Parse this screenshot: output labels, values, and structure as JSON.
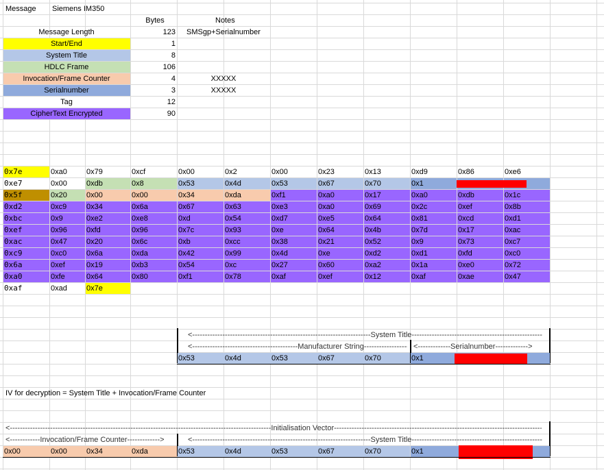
{
  "colors": {
    "start_end": "#ffff00",
    "system_title": "#b4c7e7",
    "hdlc_frame": "#c5e0b4",
    "invocation": "#f8cbad",
    "serialnumber": "#8faadc",
    "tag": "#ffffff",
    "ciphertext": "#9966ff",
    "tag_cell": "#bf8f00",
    "redaction": "#ff0000"
  },
  "header": {
    "message_label": "Message",
    "message_value": "Siemens IM350",
    "bytes_header": "Bytes",
    "notes_header": "Notes"
  },
  "summary": [
    {
      "label": "Message Length",
      "bytes": "123",
      "notes": "SMSgp+Serialnumber",
      "color": ""
    },
    {
      "label": "Start/End",
      "bytes": "1",
      "notes": "",
      "color": "#ffff00"
    },
    {
      "label": "System Title",
      "bytes": "8",
      "notes": "",
      "color": "#b4c7e7"
    },
    {
      "label": "HDLC Frame",
      "bytes": "106",
      "notes": "",
      "color": "#c5e0b4"
    },
    {
      "label": "Invocation/Frame Counter",
      "bytes": "4",
      "notes": "XXXXX",
      "color": "#f8cbad"
    },
    {
      "label": "Serialnumber",
      "bytes": "3",
      "notes": "XXXXX",
      "color": "#8faadc"
    },
    {
      "label": "Tag",
      "bytes": "12",
      "notes": "",
      "color": "#ffffff"
    },
    {
      "label": "CipherText Encrypted",
      "bytes": "90",
      "notes": "",
      "color": "#9966ff"
    }
  ],
  "hex_rows": [
    [
      "0x7e",
      "0xa0",
      "0x79",
      "0xcf",
      "0x00",
      "0x2",
      "0x00",
      "0x23",
      "0x13",
      "0xd9",
      "0x86",
      "0xe6"
    ],
    [
      "0xe7",
      "0x00",
      "0xdb",
      "0x8",
      "0x53",
      "0x4d",
      "0x53",
      "0x67",
      "0x70",
      "0x1",
      "",
      ""
    ],
    [
      "0x5f",
      "0x20",
      "0x00",
      "0x00",
      "0x34",
      "0xda",
      "0xf1",
      "0xa0",
      "0x17",
      "0xa0",
      "0xdb",
      "0x1c"
    ],
    [
      "0xd2",
      "0xc9",
      "0x34",
      "0x6a",
      "0x67",
      "0x63",
      "0xe3",
      "0xa0",
      "0x69",
      "0x2c",
      "0xef",
      "0x8b"
    ],
    [
      "0xbc",
      "0x9",
      "0xe2",
      "0xe8",
      "0xd",
      "0x54",
      "0xd7",
      "0xe5",
      "0x64",
      "0x81",
      "0xcd",
      "0xd1"
    ],
    [
      "0xef",
      "0x96",
      "0xfd",
      "0x96",
      "0x7c",
      "0x93",
      "0xe",
      "0x64",
      "0x4b",
      "0x7d",
      "0x17",
      "0xac"
    ],
    [
      "0xac",
      "0x47",
      "0x20",
      "0x6c",
      "0xb",
      "0xcc",
      "0x38",
      "0x21",
      "0x52",
      "0x9",
      "0x73",
      "0xc7"
    ],
    [
      "0xc9",
      "0xc0",
      "0x6a",
      "0xda",
      "0x42",
      "0x99",
      "0x4d",
      "0xe",
      "0xd2",
      "0xd1",
      "0xfd",
      "0xc0"
    ],
    [
      "0x6a",
      "0xef",
      "0x19",
      "0xb3",
      "0x54",
      "0xc",
      "0x27",
      "0x60",
      "0xa2",
      "0x1a",
      "0xe0",
      "0x72"
    ],
    [
      "0xa0",
      "0xfe",
      "0x64",
      "0x80",
      "0xf1",
      "0x78",
      "0xaf",
      "0xef",
      "0x12",
      "0xaf",
      "0xae",
      "0x47"
    ],
    [
      "0xaf",
      "0xad",
      "0x7e",
      "",
      "",
      "",
      "",
      "",
      "",
      "",
      "",
      ""
    ]
  ],
  "system_title_block": {
    "system_title_arrow": "<-----------------------------------------------------------------------System Title--------------------------------------------------------------->",
    "manufacturer_arrow": "<------------------------------------------Manufacturer String--------------------------------->",
    "serialnumber_arrow": "<-------------Serialnumber------------->",
    "values": [
      "0x53",
      "0x4d",
      "0x53",
      "0x67",
      "0x70",
      "0x1"
    ]
  },
  "iv_note": "IV for decryption = System Title + Invocation/Frame Counter",
  "iv_block": {
    "iv_arrow": "<--------------------------------------------------------------------------------------------------------Initialisation Vector--------------------------------------------------------------------------------------------------------->",
    "invocation_arrow": "<------------Invocation/Frame Counter------------->",
    "system_title_arrow": "<-----------------------------------------------------------------------System Title--------------------------------------------------------------->",
    "invocation_values": [
      "0x00",
      "0x00",
      "0x34",
      "0xda"
    ],
    "system_title_values": [
      "0x53",
      "0x4d",
      "0x53",
      "0x67",
      "0x70",
      "0x1"
    ]
  }
}
